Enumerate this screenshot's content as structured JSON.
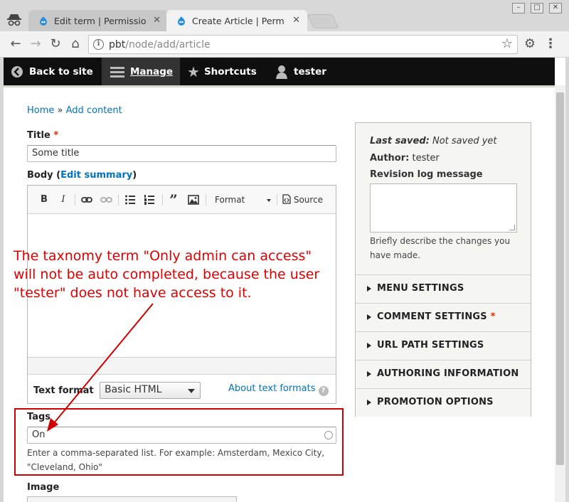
{
  "browser": {
    "tabs": [
      {
        "title": "Edit term | Permissions",
        "active": false
      },
      {
        "title": "Create Article | Permissions",
        "active": true
      }
    ],
    "url_host": "pbt",
    "url_path": "/node/add/article"
  },
  "admin_toolbar": {
    "back_to_site": "Back to site",
    "manage": "Manage",
    "shortcuts": "Shortcuts",
    "user": "tester"
  },
  "breadcrumb": {
    "home": "Home",
    "separator": "»",
    "add_content": "Add content"
  },
  "form": {
    "title_label": "Title",
    "required_marker": "*",
    "title_value": "Some title",
    "body_label": "Body",
    "body_open_paren": "(",
    "edit_summary": "Edit summary",
    "body_close_paren": ")",
    "editor_toolbar": {
      "bold": "B",
      "italic": "I",
      "format_label": "Format",
      "source_label": "Source"
    },
    "text_format_label": "Text format",
    "text_format_value": "Basic HTML",
    "about_text_formats": "About text formats",
    "help_icon": "?",
    "tags_label": "Tags",
    "tags_value": "On",
    "tags_description_line1": "Enter a comma-separated list. For example: Amsterdam, Mexico City,",
    "tags_description_line2": "\"Cleveland, Ohio\"",
    "image_label": "Image"
  },
  "annotation": {
    "line1": "The taxnomy term \"Only admin can access\"",
    "line2": "will not be auto completed, because the user",
    "line3": "\"tester\" does not have access to it.",
    "color": "#e00000"
  },
  "sidebar": {
    "last_saved_label": "Last saved:",
    "last_saved_value": "Not saved yet",
    "author_label": "Author:",
    "author_value": "tester",
    "revision_label": "Revision log message",
    "revision_help_line1": "Briefly describe the changes you",
    "revision_help_line2": "have made.",
    "sections": [
      {
        "label": "MENU SETTINGS",
        "required": false
      },
      {
        "label": "COMMENT SETTINGS",
        "required": true
      },
      {
        "label": "URL PATH SETTINGS",
        "required": false
      },
      {
        "label": "AUTHORING INFORMATION",
        "required": false
      },
      {
        "label": "PROMOTION OPTIONS",
        "required": false
      }
    ]
  },
  "colors": {
    "link": "#0074bd",
    "required": "#e62600",
    "admin_bar": "#0f0f0f"
  }
}
